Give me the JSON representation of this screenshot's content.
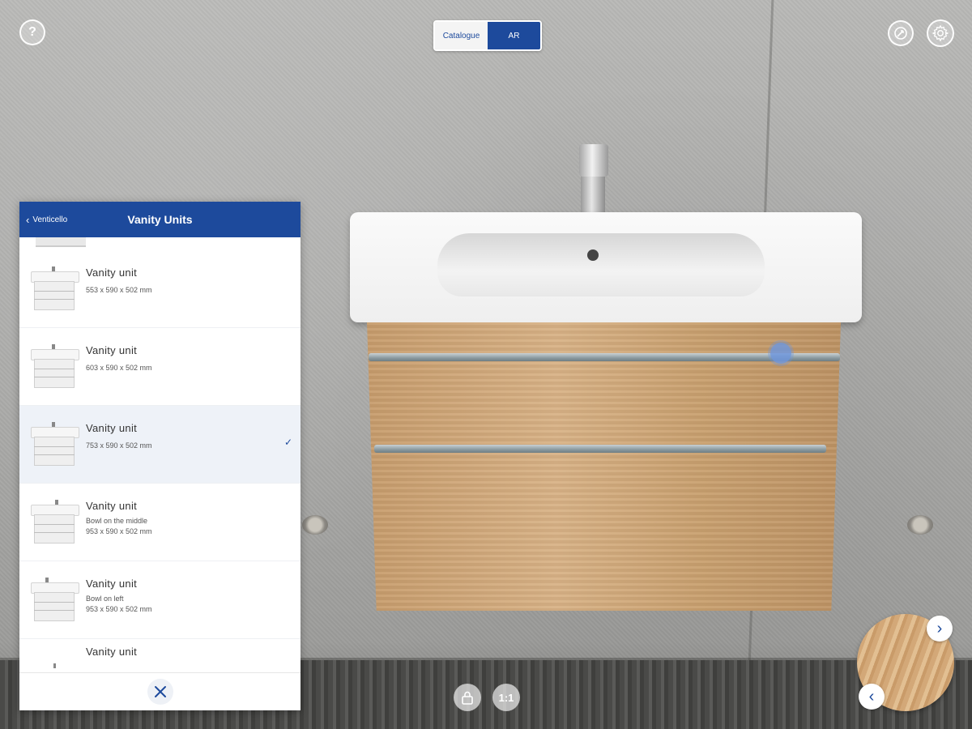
{
  "toolbar": {
    "view_toggle": {
      "options": [
        "Catalogue",
        "AR"
      ],
      "selected": "AR"
    },
    "icons": {
      "help": "question-circle-icon",
      "measure": "compass-measure-icon",
      "settings": "gear-icon"
    }
  },
  "panel": {
    "back_label": "Venticello",
    "title": "Vanity Units",
    "items": [
      {
        "name": "Vanity unit",
        "line1": "553 x 590 x 502 mm",
        "line2": "",
        "selected": false
      },
      {
        "name": "Vanity unit",
        "line1": "603 x 590 x 502 mm",
        "line2": "",
        "selected": false
      },
      {
        "name": "Vanity unit",
        "line1": "753 x 590 x 502 mm",
        "line2": "",
        "selected": true
      },
      {
        "name": "Vanity unit",
        "line1": "Bowl on the middle",
        "line2": "953 x 590 x 502 mm",
        "selected": false
      },
      {
        "name": "Vanity unit",
        "line1": "Bowl on left",
        "line2": "953 x 590 x 502 mm",
        "selected": false
      },
      {
        "name": "Vanity unit",
        "line1": "",
        "line2": "",
        "selected": false
      }
    ]
  },
  "bottom_controls": {
    "scale_label": "1:1",
    "lock_icon": "lock-icon"
  },
  "colors": {
    "accent": "#1d4a9c",
    "selected_row": "#eef2f8"
  }
}
